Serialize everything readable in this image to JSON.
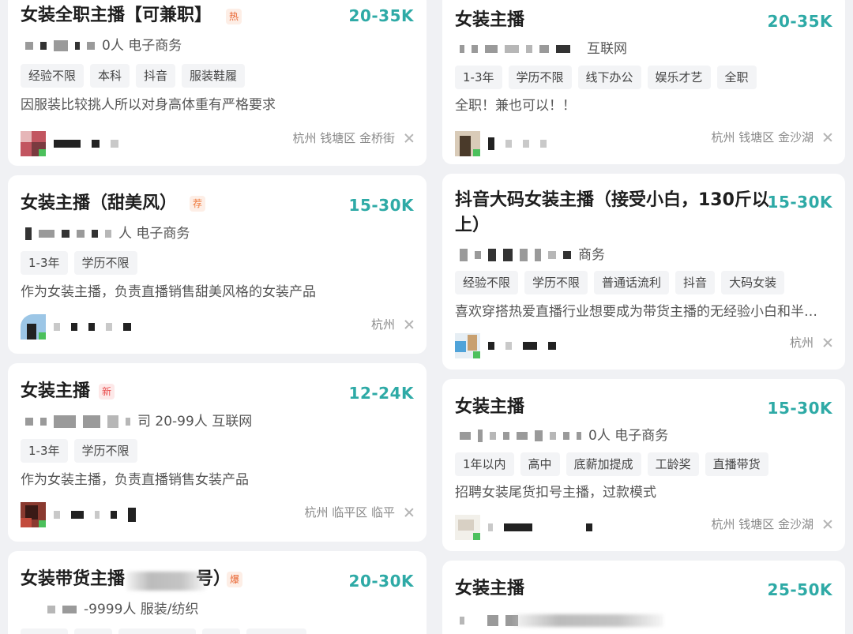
{
  "jobs": [
    {
      "title": "女装全职主播【可兼职】",
      "badge": "热",
      "salary": "20-35K",
      "company_suffix": "0人 电子商务",
      "tags": [
        "经验不限",
        "本科",
        "抖音",
        "服装鞋履"
      ],
      "desc": "因服装比较挑人所以对身高体重有严格要求",
      "location": "杭州 钱塘区 金桥街"
    },
    {
      "title": "女装主播",
      "salary": "20-35K",
      "company_suffix": "互联网",
      "tags": [
        "1-3年",
        "学历不限",
        "线下办公",
        "娱乐才艺",
        "全职"
      ],
      "desc": "全职！兼也可以！！",
      "location": "杭州 钱塘区 金沙湖"
    },
    {
      "title": "女装主播（甜美风）",
      "badge": "荐",
      "salary": "15-30K",
      "company_suffix": "人 电子商务",
      "tags": [
        "1-3年",
        "学历不限"
      ],
      "desc": "作为女装主播，负责直播销售甜美风格的女装产品",
      "location": "杭州"
    },
    {
      "title": "抖音大码女装主播（接受小白，130斤以上）",
      "salary": "15-30K",
      "company_suffix": "商务",
      "tags": [
        "经验不限",
        "学历不限",
        "普通话流利",
        "抖音",
        "大码女装"
      ],
      "desc": "喜欢穿搭热爱直播行业想要成为带货主播的无经验小白和半…",
      "location": "杭州"
    },
    {
      "title": "女装主播",
      "badge": "新",
      "salary": "12-24K",
      "company_suffix": "司 20-99人 互联网",
      "tags": [
        "1-3年",
        "学历不限"
      ],
      "desc": "作为女装主播，负责直播销售女装产品",
      "location": "杭州 临平区 临平"
    },
    {
      "title": "女装主播",
      "salary": "15-30K",
      "company_suffix": "0人 电子商务",
      "tags": [
        "1年以内",
        "高中",
        "底薪加提成",
        "工龄奖",
        "直播带货"
      ],
      "desc": "招聘女装尾货扣号主播，过款模式",
      "location": "杭州 钱塘区 金沙湖"
    },
    {
      "title_start": "女装带货主播",
      "title_end": "号）",
      "badge": "爆",
      "salary": "20-30K",
      "company_suffix": "-9999人 服装/纺织"
    },
    {
      "title": "女装主播",
      "salary": "25-50K"
    }
  ],
  "colors": {
    "salary": "#2eaaa6",
    "background": "#f0f1f4",
    "card": "#ffffff",
    "online_dot": "#4cc05c"
  }
}
